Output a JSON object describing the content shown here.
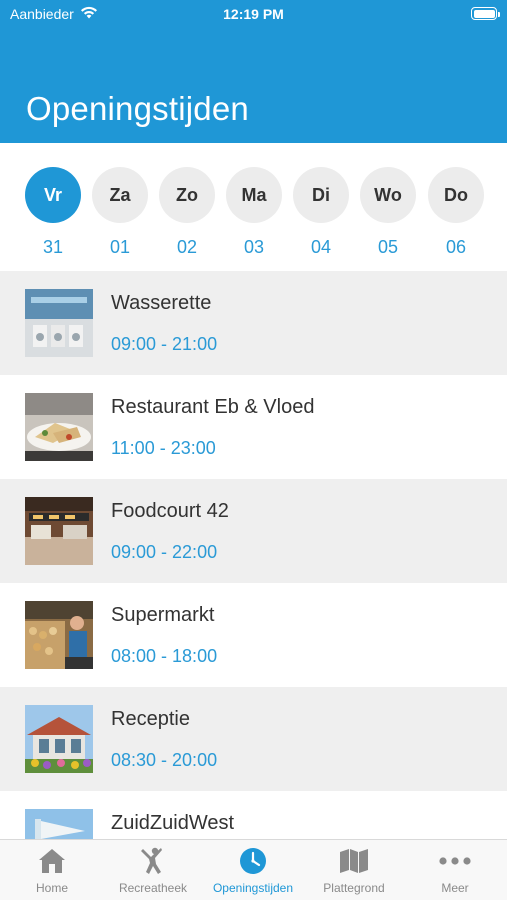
{
  "status_bar": {
    "carrier": "Aanbieder",
    "time": "12:19 PM"
  },
  "header": {
    "title": "Openingstijden"
  },
  "days": [
    {
      "label": "Vr",
      "date": "31",
      "selected": true
    },
    {
      "label": "Za",
      "date": "01",
      "selected": false
    },
    {
      "label": "Zo",
      "date": "02",
      "selected": false
    },
    {
      "label": "Ma",
      "date": "03",
      "selected": false
    },
    {
      "label": "Di",
      "date": "04",
      "selected": false
    },
    {
      "label": "Wo",
      "date": "05",
      "selected": false
    },
    {
      "label": "Do",
      "date": "06",
      "selected": false
    }
  ],
  "locations": [
    {
      "name": "Wasserette",
      "hours": "09:00 - 21:00",
      "icon": "laundry-photo"
    },
    {
      "name": "Restaurant Eb & Vloed",
      "hours": "11:00 - 23:00",
      "icon": "restaurant-photo"
    },
    {
      "name": "Foodcourt 42",
      "hours": "09:00 - 22:00",
      "icon": "foodcourt-photo"
    },
    {
      "name": "Supermarkt",
      "hours": "08:00 - 18:00",
      "icon": "supermarket-photo"
    },
    {
      "name": "Receptie",
      "hours": "08:30 - 20:00",
      "icon": "reception-photo"
    },
    {
      "name": "ZuidZuidWest",
      "hours": "",
      "icon": "zuidzuidwest-photo"
    }
  ],
  "tabbar": {
    "active": "Openingstijden",
    "tabs": [
      {
        "label": "Home",
        "icon": "home-icon"
      },
      {
        "label": "Recreatheek",
        "icon": "dancer-icon"
      },
      {
        "label": "Openingstijden",
        "icon": "clock-icon"
      },
      {
        "label": "Plattegrond",
        "icon": "map-icon"
      },
      {
        "label": "Meer",
        "icon": "more-icon"
      }
    ]
  },
  "colors": {
    "brand": "#1f97d6",
    "accent_text": "#2a9ad6",
    "row_shade": "#efefef"
  }
}
